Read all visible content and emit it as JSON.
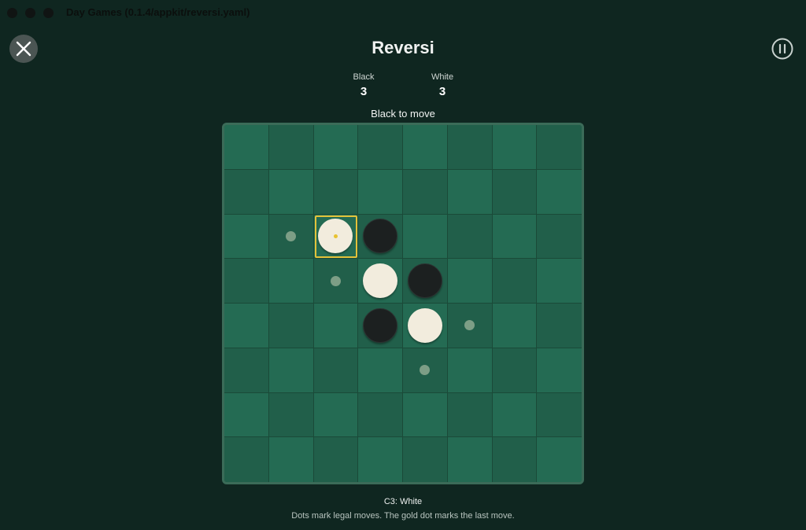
{
  "window": {
    "title": "Day Games (0.1.4/appkit/reversi.yaml)"
  },
  "game": {
    "title": "Reversi",
    "status": "Black to move"
  },
  "scores": [
    {
      "label": "Black",
      "value": "3"
    },
    {
      "label": "White",
      "value": "3"
    }
  ],
  "board": {
    "size": 8,
    "last_move": "C3",
    "pieces": [
      {
        "cell": "C3",
        "color": "white"
      },
      {
        "cell": "D3",
        "color": "black"
      },
      {
        "cell": "D4",
        "color": "white"
      },
      {
        "cell": "E4",
        "color": "black"
      },
      {
        "cell": "D5",
        "color": "black"
      },
      {
        "cell": "E5",
        "color": "white"
      }
    ],
    "legal_moves": [
      "B3",
      "C4",
      "F5",
      "E6"
    ]
  },
  "footer": {
    "move_text": "C3: White",
    "note": "Dots mark legal moves. The gold dot marks the last move."
  },
  "colors": {
    "background": "#0f2620",
    "board_light": "#246b53",
    "board_dark": "#215f4a",
    "last_move_highlight": "#e3c23a"
  }
}
